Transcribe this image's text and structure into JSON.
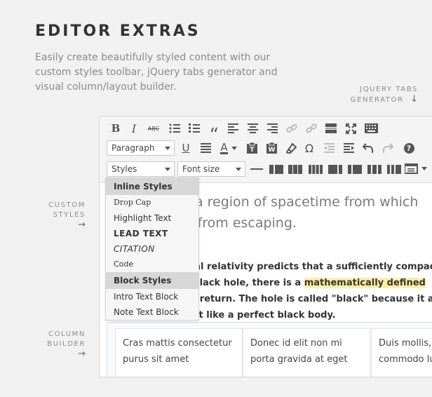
{
  "header": {
    "title": "EDITOR EXTRAS",
    "intro": "Easily create beautifully styled content with our custom styles toolbar, jQuery tabs generator and visual column/layout builder."
  },
  "callouts": {
    "tabs": [
      "JQUERY TABS",
      "GENERATOR"
    ],
    "styles": [
      "CUSTOM",
      "STYLES"
    ],
    "column": [
      "COLUMN",
      "BUILDER"
    ],
    "arrow_down": "↓",
    "arrow_right": "→"
  },
  "toolbar": {
    "format_select": "Paragraph",
    "styles_select": "Styles",
    "fontsize_select": "Font size",
    "bold": "B",
    "italic": "I",
    "strike": "ABC",
    "blockquote": "“",
    "omega": "Ω",
    "help": "?",
    "textcolor": "A",
    "underline": "U"
  },
  "dropdown": {
    "inline_header": "Inline Styles",
    "inline_items": [
      "Drop Cap",
      "Highlight Text",
      "LEAD TEXT",
      "CITATION",
      "Code"
    ],
    "block_header": "Block Styles",
    "block_items": [
      "Intro Text Block",
      "Note Text Block"
    ]
  },
  "content": {
    "heading_line1": "s a region of spacetime from which",
    "heading_line2": "t, from escaping.",
    "para_line1": "eral relativity predicts that a sufficiently compact",
    "para_line2_pre": "a black hole, there is a ",
    "para_highlight": "mathematically defined",
    "para_line3_pre": "no return. The hole is called \"",
    "para_black": "black",
    "para_line3_post": "\" because it a",
    "para_line4": "just like a perfect black body.",
    "columns": [
      {
        "line1": "Cras mattis consectetur",
        "line2": "purus sit amet"
      },
      {
        "line1": "Donec id elit non mi",
        "line2": "porta gravida at eget"
      },
      {
        "line1": "Duis mollis,",
        "line2": "commodo lu"
      }
    ]
  },
  "colors": {
    "background": "#f1f1f1",
    "highlight": "#fdf0a6",
    "dropdown_header": "#d7d7d7"
  }
}
